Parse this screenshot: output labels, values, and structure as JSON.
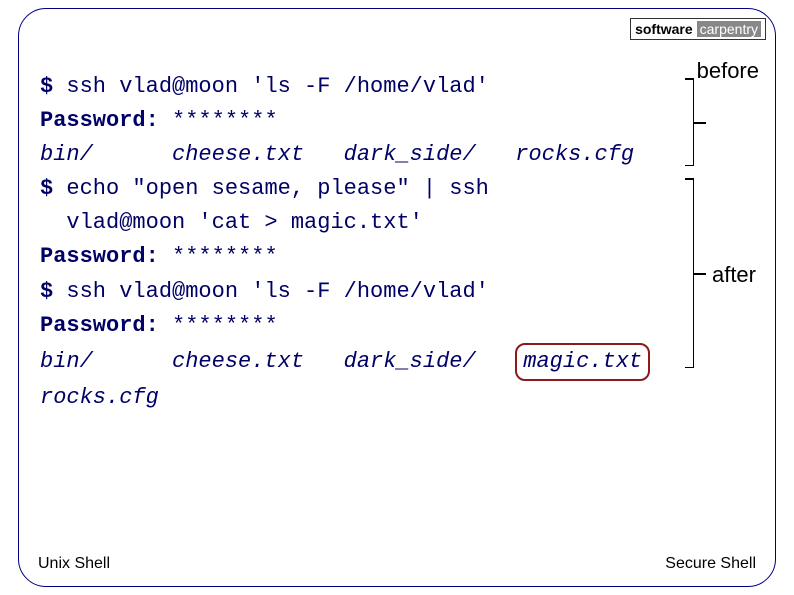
{
  "logo": {
    "word1": "software",
    "word2": "carpentry"
  },
  "annotations": {
    "before": "before",
    "after": "after"
  },
  "terminal": {
    "l1_prompt": "$",
    "l1_cmd": " ssh vlad@moon 'ls -F /home/vlad'",
    "l2_label": "Password:",
    "l2_val": " ********",
    "l3": "bin/      cheese.txt   dark_side/   rocks.cfg",
    "l4_prompt": "$",
    "l4_cmd": " echo \"open sesame, please\" | ssh",
    "l5": "  vlad@moon 'cat > magic.txt'",
    "l6_label": "Password:",
    "l6_val": " ********",
    "l7_prompt": "$",
    "l7_cmd": " ssh vlad@moon 'ls -F /home/vlad'",
    "l8_label": "Password:",
    "l8_val": " ********",
    "l9a": "bin/      cheese.txt   dark_side/   ",
    "l9b": "magic.txt",
    "l10": "rocks.cfg"
  },
  "footer": {
    "left": "Unix Shell",
    "right": "Secure Shell"
  }
}
